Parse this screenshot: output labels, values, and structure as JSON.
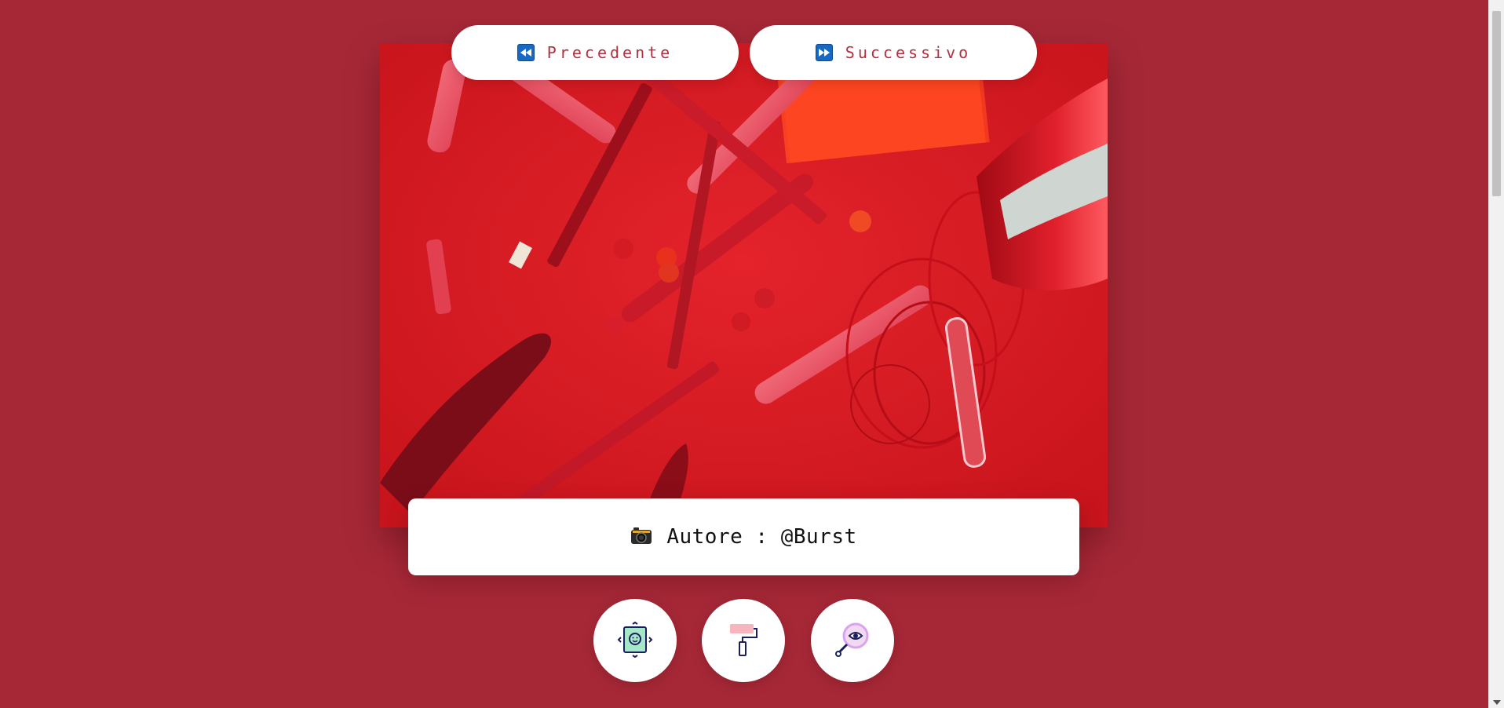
{
  "navigation": {
    "prev_label": "Precedente",
    "next_label": "Successivo",
    "prev_icon": "rewind-icon",
    "next_icon": "fast-forward-icon"
  },
  "photo": {
    "subject": "red stationery flat lay"
  },
  "credit": {
    "icon": "camera-icon",
    "text": "Autore : @Burst"
  },
  "tools": [
    {
      "icon": "face-frame-icon"
    },
    {
      "icon": "paint-roller-icon"
    },
    {
      "icon": "magnifier-eye-icon"
    }
  ],
  "colors": {
    "background": "#a62837",
    "button_text": "#b23040",
    "nav_icon": "#1769c4",
    "card": "#ffffff"
  }
}
